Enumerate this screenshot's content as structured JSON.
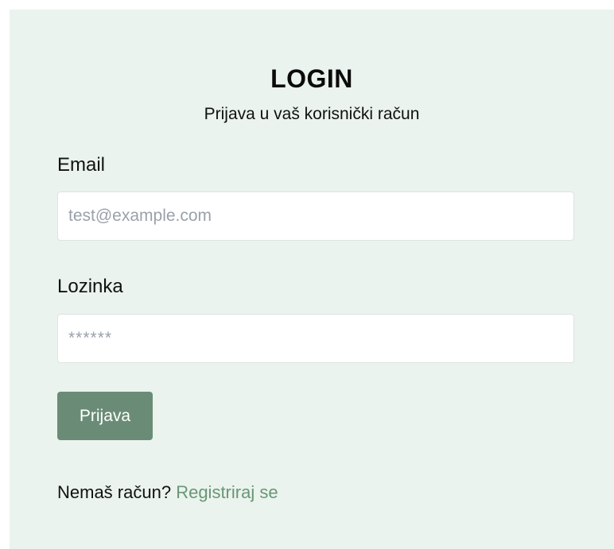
{
  "login": {
    "title": "LOGIN",
    "subtitle": "Prijava u vaš korisnički račun",
    "email_label": "Email",
    "email_placeholder": "test@example.com",
    "email_value": "",
    "password_label": "Lozinka",
    "password_placeholder": "******",
    "password_value": "",
    "submit_label": "Prijava",
    "footer_text": "Nemaš račun?",
    "register_link": "Registriraj se"
  },
  "colors": {
    "panel_background": "#eaf3ed",
    "button_background": "#6a8c76",
    "link_color": "#6a9677"
  }
}
